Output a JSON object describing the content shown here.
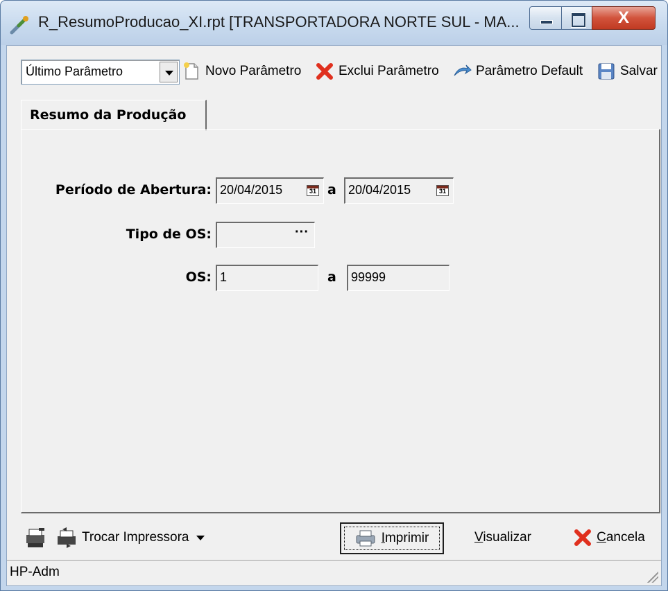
{
  "window": {
    "title": "R_ResumoProducao_XI.rpt [TRANSPORTADORA NORTE SUL -  MA...",
    "close_label": "X"
  },
  "toolbar": {
    "parameter_select": "Último Parâmetro",
    "novo": "Novo Parâmetro",
    "exclui": "Exclui Parâmetro",
    "default": "Parâmetro Default",
    "salvar": "Salvar"
  },
  "tabs": [
    {
      "label": "Resumo da Produção",
      "active": true
    }
  ],
  "form": {
    "periodo_label": "Período de Abertura:",
    "periodo_from": "20/04/2015",
    "periodo_to": "20/04/2015",
    "separator": "a",
    "tipo_label": "Tipo de OS:",
    "tipo_value": "",
    "ellipsis": "···",
    "os_label": "OS:",
    "os_from": "1",
    "os_to": "99999"
  },
  "footer": {
    "trocar_impressora": "Trocar Impressora",
    "imprimir_accel": "I",
    "imprimir_rest": "mprimir",
    "visualizar_accel": "V",
    "visualizar_rest": "isualizar",
    "cancela_accel": "C",
    "cancela_rest": "ancela"
  },
  "status": {
    "printer": "HP-Adm"
  },
  "icons": {
    "app": "tools-icon",
    "novo": "new-document-icon",
    "exclui": "red-x-icon",
    "default": "blue-arrow-icon",
    "salvar": "floppy-disk-icon",
    "printer_settings": "printer-settings-icon",
    "swap_printer": "swap-printer-icon",
    "imprimir": "printer-icon",
    "cancela": "red-x-icon"
  },
  "colors": {
    "titlebar": "#c8daee",
    "close_button": "#d2533c",
    "window_background": "#f0f0f0",
    "cancel_icon": "#e0301e"
  }
}
